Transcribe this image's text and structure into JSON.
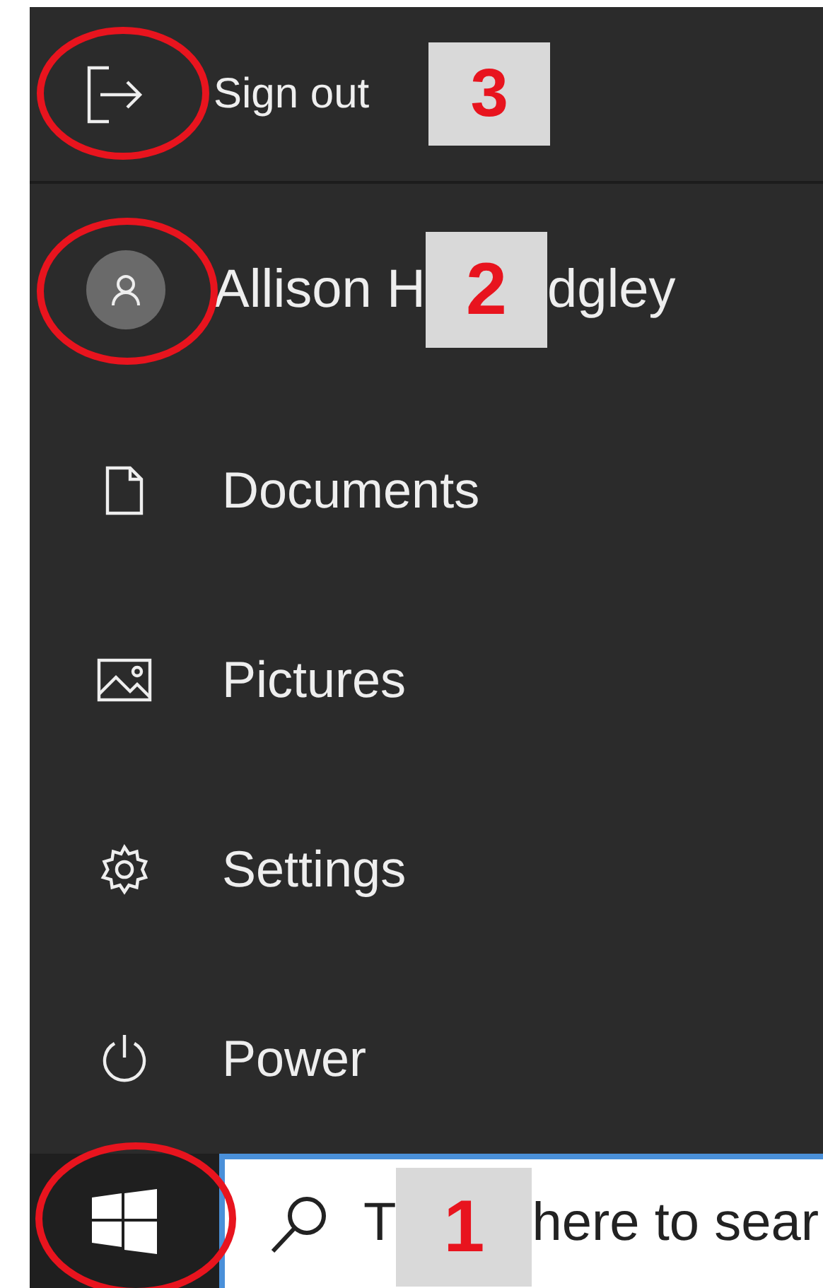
{
  "sign_out": {
    "label": "Sign out",
    "circled": true,
    "badge": "3"
  },
  "user": {
    "name_start": "Allison H",
    "badge": "2",
    "name_end": "dgley",
    "circled": true
  },
  "items": [
    {
      "kind": "documents",
      "label": "Documents"
    },
    {
      "kind": "pictures",
      "label": "Pictures"
    },
    {
      "kind": "settings",
      "label": "Settings"
    },
    {
      "kind": "power",
      "label": "Power"
    }
  ],
  "taskbar": {
    "start_circled": true,
    "search_start": "T",
    "badge": "1",
    "search_end": "here to sear"
  }
}
